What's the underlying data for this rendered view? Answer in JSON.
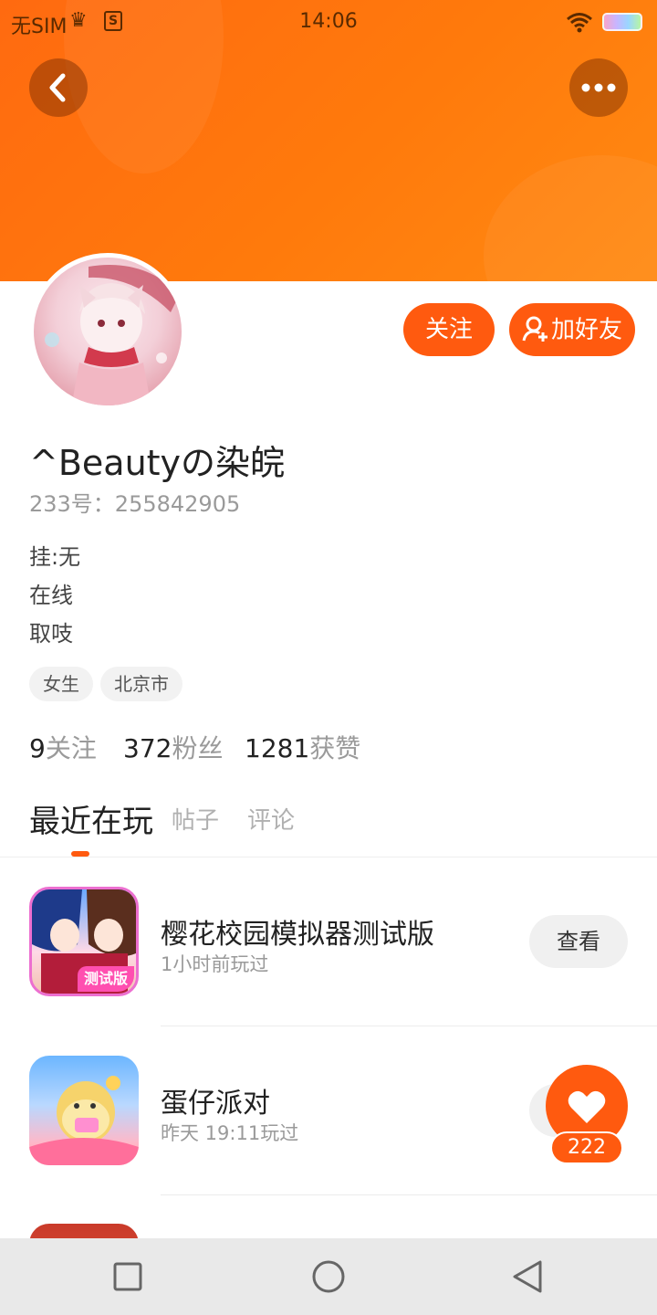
{
  "status_bar": {
    "carrier": "无SIM",
    "time": "14:06",
    "s_badge": "S"
  },
  "header": {
    "back_icon": "chevron-left-icon",
    "more_icon": "more-horizontal-icon",
    "accent_color": "#ff6a10"
  },
  "profile": {
    "follow_label": "关注",
    "add_friend_label": "加好友",
    "username": "^Beautyの染皖",
    "id_text": "233号：255842905",
    "bio": [
      "挂:无",
      "在线",
      "取吱"
    ],
    "tags": [
      "女生",
      "北京市"
    ],
    "stats": [
      {
        "value": "9",
        "label": "关注"
      },
      {
        "value": "372",
        "label": "粉丝"
      },
      {
        "value": "1281",
        "label": "获赞"
      }
    ]
  },
  "tabs": [
    "最近在玩",
    "帖子",
    "评论"
  ],
  "games": [
    {
      "title": "樱花校园模拟器测试版",
      "subtitle": "1小时前玩过",
      "icon_badge": "测试版",
      "action": "查看"
    },
    {
      "title": "蛋仔派对",
      "subtitle": "昨天 19:11玩过",
      "action": "查看"
    }
  ],
  "fab": {
    "icon": "heart-icon",
    "count": "222"
  },
  "nav": {
    "icons": [
      "square-icon",
      "circle-icon",
      "triangle-back-icon"
    ]
  }
}
